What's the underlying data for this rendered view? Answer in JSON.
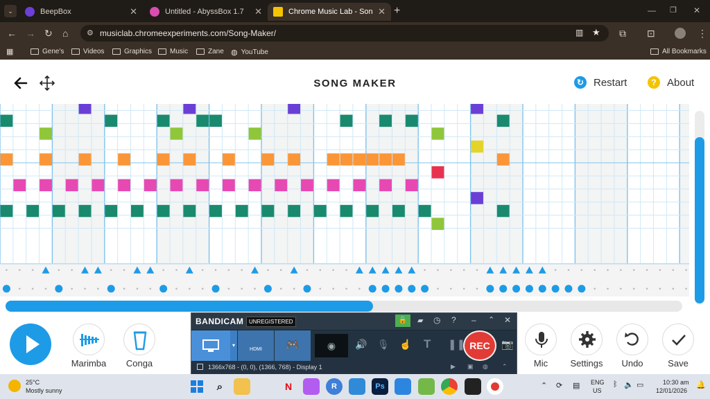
{
  "browser": {
    "tabs": [
      {
        "title": "BeepBox",
        "active": false,
        "favicon_color": "#6d3fd6"
      },
      {
        "title": "Untitled - AbyssBox 1.7",
        "active": false,
        "favicon_color": "#d94cb0"
      },
      {
        "title": "Chrome Music Lab - Song Make",
        "active": true,
        "favicon_color": "#f5c400"
      }
    ],
    "new_tab_label": "+",
    "url": "musiclab.chromeexperiments.com/Song-Maker/",
    "bookmarks": [
      "Gene's",
      "Videos",
      "Graphics",
      "Music",
      "Zane",
      "YouTube"
    ],
    "all_bookmarks_label": "All Bookmarks"
  },
  "app": {
    "title": "SONG MAKER",
    "restart_label": "Restart",
    "about_label": "About",
    "instrument_label": "Marimba",
    "percussion_label": "Conga",
    "controls": {
      "mic": "Mic",
      "settings": "Settings",
      "undo": "Undo",
      "save": "Save"
    },
    "horizontal_scroll_fraction": 0.54
  },
  "notes": [
    {
      "c": 0,
      "r": 4,
      "color": "#1a8a6e"
    },
    {
      "c": 0,
      "r": 7,
      "color": "#fb9638"
    },
    {
      "c": 1,
      "r": 9,
      "color": "#e749b3"
    },
    {
      "c": 0,
      "r": 11,
      "color": "#1a8a6e"
    },
    {
      "c": 3,
      "r": 5,
      "color": "#8fc63a"
    },
    {
      "c": 3,
      "r": 7,
      "color": "#fb9638"
    },
    {
      "c": 2,
      "r": 11,
      "color": "#1a8a6e"
    },
    {
      "c": 3,
      "r": 9,
      "color": "#e749b3"
    },
    {
      "c": 4,
      "r": 11,
      "color": "#1a8a6e"
    },
    {
      "c": 5,
      "r": 9,
      "color": "#e749b3"
    },
    {
      "c": 6,
      "r": 3,
      "color": "#6a3fd6"
    },
    {
      "c": 6,
      "r": 7,
      "color": "#fb9638"
    },
    {
      "c": 6,
      "r": 11,
      "color": "#1a8a6e"
    },
    {
      "c": 7,
      "r": 9,
      "color": "#e749b3"
    },
    {
      "c": 8,
      "r": 4,
      "color": "#1a8a6e"
    },
    {
      "c": 8,
      "r": 11,
      "color": "#1a8a6e"
    },
    {
      "c": 9,
      "r": 7,
      "color": "#fb9638"
    },
    {
      "c": 9,
      "r": 9,
      "color": "#e749b3"
    },
    {
      "c": 10,
      "r": 11,
      "color": "#1a8a6e"
    },
    {
      "c": 11,
      "r": 9,
      "color": "#e749b3"
    },
    {
      "c": 12,
      "r": 4,
      "color": "#1a8a6e"
    },
    {
      "c": 12,
      "r": 7,
      "color": "#fb9638"
    },
    {
      "c": 12,
      "r": 11,
      "color": "#1a8a6e"
    },
    {
      "c": 13,
      "r": 5,
      "color": "#8fc63a"
    },
    {
      "c": 13,
      "r": 9,
      "color": "#e749b3"
    },
    {
      "c": 14,
      "r": 3,
      "color": "#6a3fd6"
    },
    {
      "c": 14,
      "r": 7,
      "color": "#fb9638"
    },
    {
      "c": 14,
      "r": 11,
      "color": "#1a8a6e"
    },
    {
      "c": 15,
      "r": 4,
      "color": "#1a8a6e"
    },
    {
      "c": 15,
      "r": 9,
      "color": "#e749b3"
    },
    {
      "c": 16,
      "r": 4,
      "color": "#1a8a6e"
    },
    {
      "c": 16,
      "r": 11,
      "color": "#1a8a6e"
    },
    {
      "c": 17,
      "r": 7,
      "color": "#fb9638"
    },
    {
      "c": 17,
      "r": 9,
      "color": "#e749b3"
    },
    {
      "c": 18,
      "r": 11,
      "color": "#1a8a6e"
    },
    {
      "c": 19,
      "r": 5,
      "color": "#8fc63a"
    },
    {
      "c": 19,
      "r": 9,
      "color": "#e749b3"
    },
    {
      "c": 20,
      "r": 7,
      "color": "#fb9638"
    },
    {
      "c": 20,
      "r": 11,
      "color": "#1a8a6e"
    },
    {
      "c": 21,
      "r": 9,
      "color": "#e749b3"
    },
    {
      "c": 22,
      "r": 3,
      "color": "#6a3fd6"
    },
    {
      "c": 22,
      "r": 7,
      "color": "#fb9638"
    },
    {
      "c": 22,
      "r": 11,
      "color": "#1a8a6e"
    },
    {
      "c": 23,
      "r": 9,
      "color": "#e749b3"
    },
    {
      "c": 24,
      "r": 11,
      "color": "#1a8a6e"
    },
    {
      "c": 25,
      "r": 7,
      "color": "#fb9638"
    },
    {
      "c": 25,
      "r": 9,
      "color": "#e749b3"
    },
    {
      "c": 26,
      "r": 4,
      "color": "#1a8a6e"
    },
    {
      "c": 26,
      "r": 7,
      "color": "#fb9638"
    },
    {
      "c": 26,
      "r": 11,
      "color": "#1a8a6e"
    },
    {
      "c": 27,
      "r": 7,
      "color": "#fb9638"
    },
    {
      "c": 27,
      "r": 9,
      "color": "#e749b3"
    },
    {
      "c": 28,
      "r": 7,
      "color": "#fb9638"
    },
    {
      "c": 28,
      "r": 11,
      "color": "#1a8a6e"
    },
    {
      "c": 29,
      "r": 4,
      "color": "#1a8a6e"
    },
    {
      "c": 29,
      "r": 7,
      "color": "#fb9638"
    },
    {
      "c": 29,
      "r": 9,
      "color": "#e749b3"
    },
    {
      "c": 30,
      "r": 7,
      "color": "#fb9638"
    },
    {
      "c": 30,
      "r": 11,
      "color": "#1a8a6e"
    },
    {
      "c": 31,
      "r": 4,
      "color": "#1a8a6e"
    },
    {
      "c": 31,
      "r": 9,
      "color": "#e749b3"
    },
    {
      "c": 32,
      "r": 11,
      "color": "#1a8a6e"
    },
    {
      "c": 33,
      "r": 8,
      "color": "#e8334f"
    },
    {
      "c": 33,
      "r": 5,
      "color": "#8fc63a"
    },
    {
      "c": 33,
      "r": 12,
      "color": "#8fc63a"
    },
    {
      "c": 36,
      "r": 3,
      "color": "#6a3fd6"
    },
    {
      "c": 36,
      "r": 6,
      "color": "#e4d42a"
    },
    {
      "c": 36,
      "r": 10,
      "color": "#6a3fd6"
    },
    {
      "c": 38,
      "r": 4,
      "color": "#1a8a6e"
    },
    {
      "c": 38,
      "r": 7,
      "color": "#fb9638"
    },
    {
      "c": 38,
      "r": 11,
      "color": "#1a8a6e"
    }
  ],
  "triangles": [
    3,
    6,
    7,
    10,
    11,
    14,
    19,
    22,
    27,
    28,
    29,
    30,
    31,
    37,
    38,
    39,
    40,
    41
  ],
  "dots": [
    0,
    4,
    8,
    12,
    16,
    20,
    23,
    28,
    29,
    30,
    31,
    32,
    37,
    38,
    39,
    40,
    41,
    42,
    43,
    44
  ],
  "bandicam": {
    "brand": "BANDICAM",
    "badge": "UNREGISTERED",
    "rec_label": "REC",
    "hdmi_label": "HDMI",
    "footer": "1366x768 - (0, 0), (1366, 768) - Display 1",
    "text_tool": "T"
  },
  "taskbar": {
    "temp": "25°C",
    "weather": "Mostly sunny",
    "lang1": "ENG",
    "lang2": "US",
    "time": "10:30 am",
    "date": "12/01/2026"
  }
}
